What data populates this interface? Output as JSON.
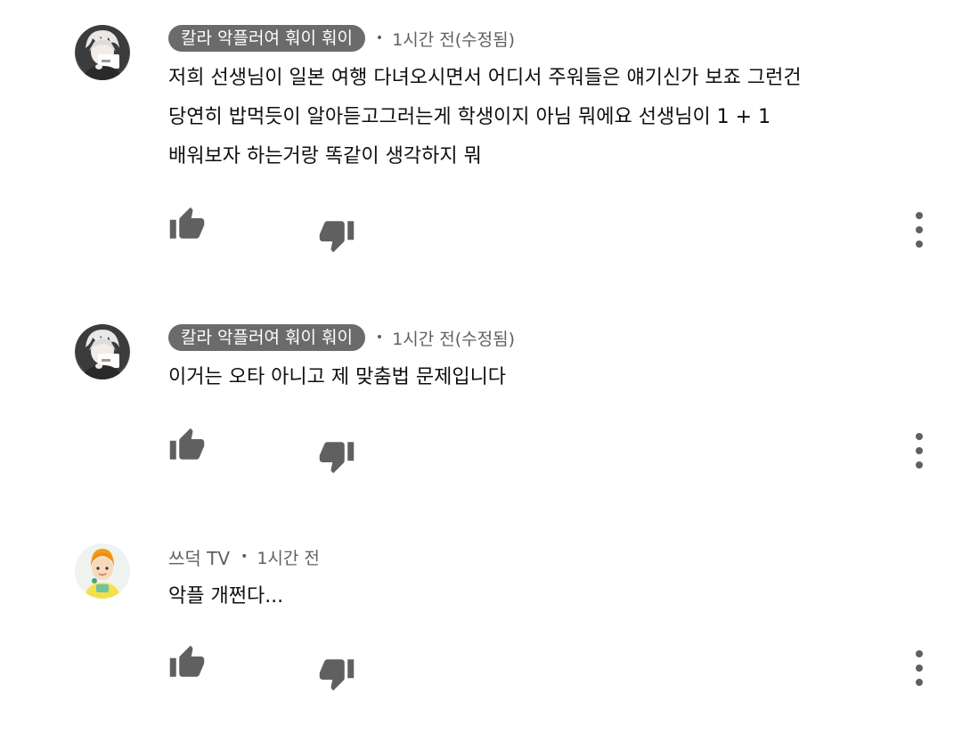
{
  "comments": [
    {
      "author": "칼라 악플러여 훠이 훠이",
      "separator": "•",
      "time": "1시간 전(수정됨)",
      "text_lines": [
        "저희 선생님이 일본 여행 다녀오시면서 어디서 주워들은 얘기신가 보죠 그런건",
        "당연히 밥먹듯이 알아듣고그러는게 학생이지 아님 뭐에요 선생님이 1 +  1",
        "배워보자 하는거랑 똑같이 생각하지 뭐"
      ],
      "avatar_icon": "anime-character-avatar-icon",
      "like_icon": "thumb-up-icon",
      "dislike_icon": "thumb-down-icon",
      "more_icon": "more-vertical-icon"
    },
    {
      "author": "칼라 악플러여 훠이 훠이",
      "separator": "•",
      "time": "1시간 전(수정됨)",
      "text_lines": [
        "이거는 오타 아니고 제 맞춤법 문제입니다"
      ],
      "avatar_icon": "anime-character-avatar-icon",
      "like_icon": "thumb-up-icon",
      "dislike_icon": "thumb-down-icon",
      "more_icon": "more-vertical-icon"
    },
    {
      "author": "쓰덕 TV",
      "separator": "•",
      "time": "1시간 전",
      "text_lines": [
        "악플 개쩐다..."
      ],
      "avatar_icon": "cartoon-person-avatar-icon",
      "like_icon": "thumb-up-icon",
      "dislike_icon": "thumb-down-icon",
      "more_icon": "more-vertical-icon"
    }
  ],
  "colors": {
    "author_pill_bg": "#6b6b6b",
    "meta_text": "#606060",
    "body_text": "#0f0f0f",
    "icon": "#606060",
    "background": "#ffffff"
  }
}
